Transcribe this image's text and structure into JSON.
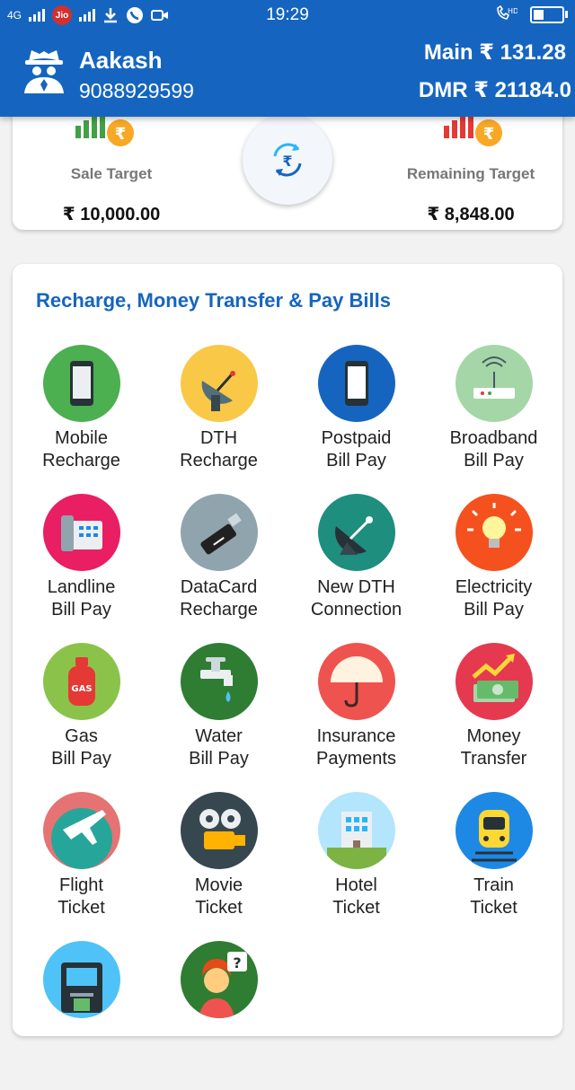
{
  "status_bar": {
    "network_left": "4G",
    "carrier": "Jio",
    "time": "19:29",
    "hd": "HD",
    "battery_percent": 35
  },
  "header": {
    "user_name": "Aakash",
    "user_phone": "9088929599",
    "main_balance": "Main ₹ 131.28",
    "dmr_balance": "DMR ₹ 21184.0"
  },
  "targets": {
    "sale": {
      "label": "Sale Target",
      "value": "₹ 10,000.00"
    },
    "remaining": {
      "label": "Remaining Target",
      "value": "₹ 8,848.00"
    }
  },
  "services": {
    "title": "Recharge, Money Transfer & Pay Bills",
    "items": [
      {
        "line1": "Mobile",
        "line2": "Recharge",
        "icon": "mobile-icon",
        "color": "#4caf50"
      },
      {
        "line1": "DTH",
        "line2": "Recharge",
        "icon": "dish-icon",
        "color": "#f9c846"
      },
      {
        "line1": "Postpaid",
        "line2": "Bill Pay",
        "icon": "postpaid-phone-icon",
        "color": "#1565c0"
      },
      {
        "line1": "Broadband",
        "line2": "Bill Pay",
        "icon": "router-icon",
        "color": "#a5d6a7"
      },
      {
        "line1": "Landline",
        "line2": "Bill Pay",
        "icon": "landline-phone-icon",
        "color": "#e91e63"
      },
      {
        "line1": "DataCard",
        "line2": "Recharge",
        "icon": "usb-datacard-icon",
        "color": "#90a4ae"
      },
      {
        "line1": "New DTH",
        "line2": "Connection",
        "icon": "satellite-dish-icon",
        "color": "#1e8e7e"
      },
      {
        "line1": "Electricity",
        "line2": "Bill Pay",
        "icon": "bulb-icon",
        "color": "#f4511e"
      },
      {
        "line1": "Gas",
        "line2": "Bill Pay",
        "icon": "gas-cylinder-icon",
        "color": "#8bc34a"
      },
      {
        "line1": "Water",
        "line2": "Bill Pay",
        "icon": "water-tap-icon",
        "color": "#2e7d32"
      },
      {
        "line1": "Insurance",
        "line2": "Payments",
        "icon": "umbrella-icon",
        "color": "#ef5350"
      },
      {
        "line1": "Money",
        "line2": "Transfer",
        "icon": "money-icon",
        "color": "#e53950"
      },
      {
        "line1": "Flight",
        "line2": "Ticket",
        "icon": "airplane-icon",
        "color": "#e57373"
      },
      {
        "line1": "Movie",
        "line2": "Ticket",
        "icon": "movie-projector-icon",
        "color": "#37474f"
      },
      {
        "line1": "Hotel",
        "line2": "Ticket",
        "icon": "hotel-icon",
        "color": "#b3e5fc"
      },
      {
        "line1": "Train",
        "line2": "Ticket",
        "icon": "train-icon",
        "color": "#1e88e5"
      },
      {
        "line1": "",
        "line2": "",
        "icon": "atm-icon",
        "color": "#4fc3f7"
      },
      {
        "line1": "",
        "line2": "",
        "icon": "support-agent-icon",
        "color": "#2e7d32"
      }
    ]
  },
  "labels": {
    "gas": "GAS",
    "rupee": "₹"
  }
}
